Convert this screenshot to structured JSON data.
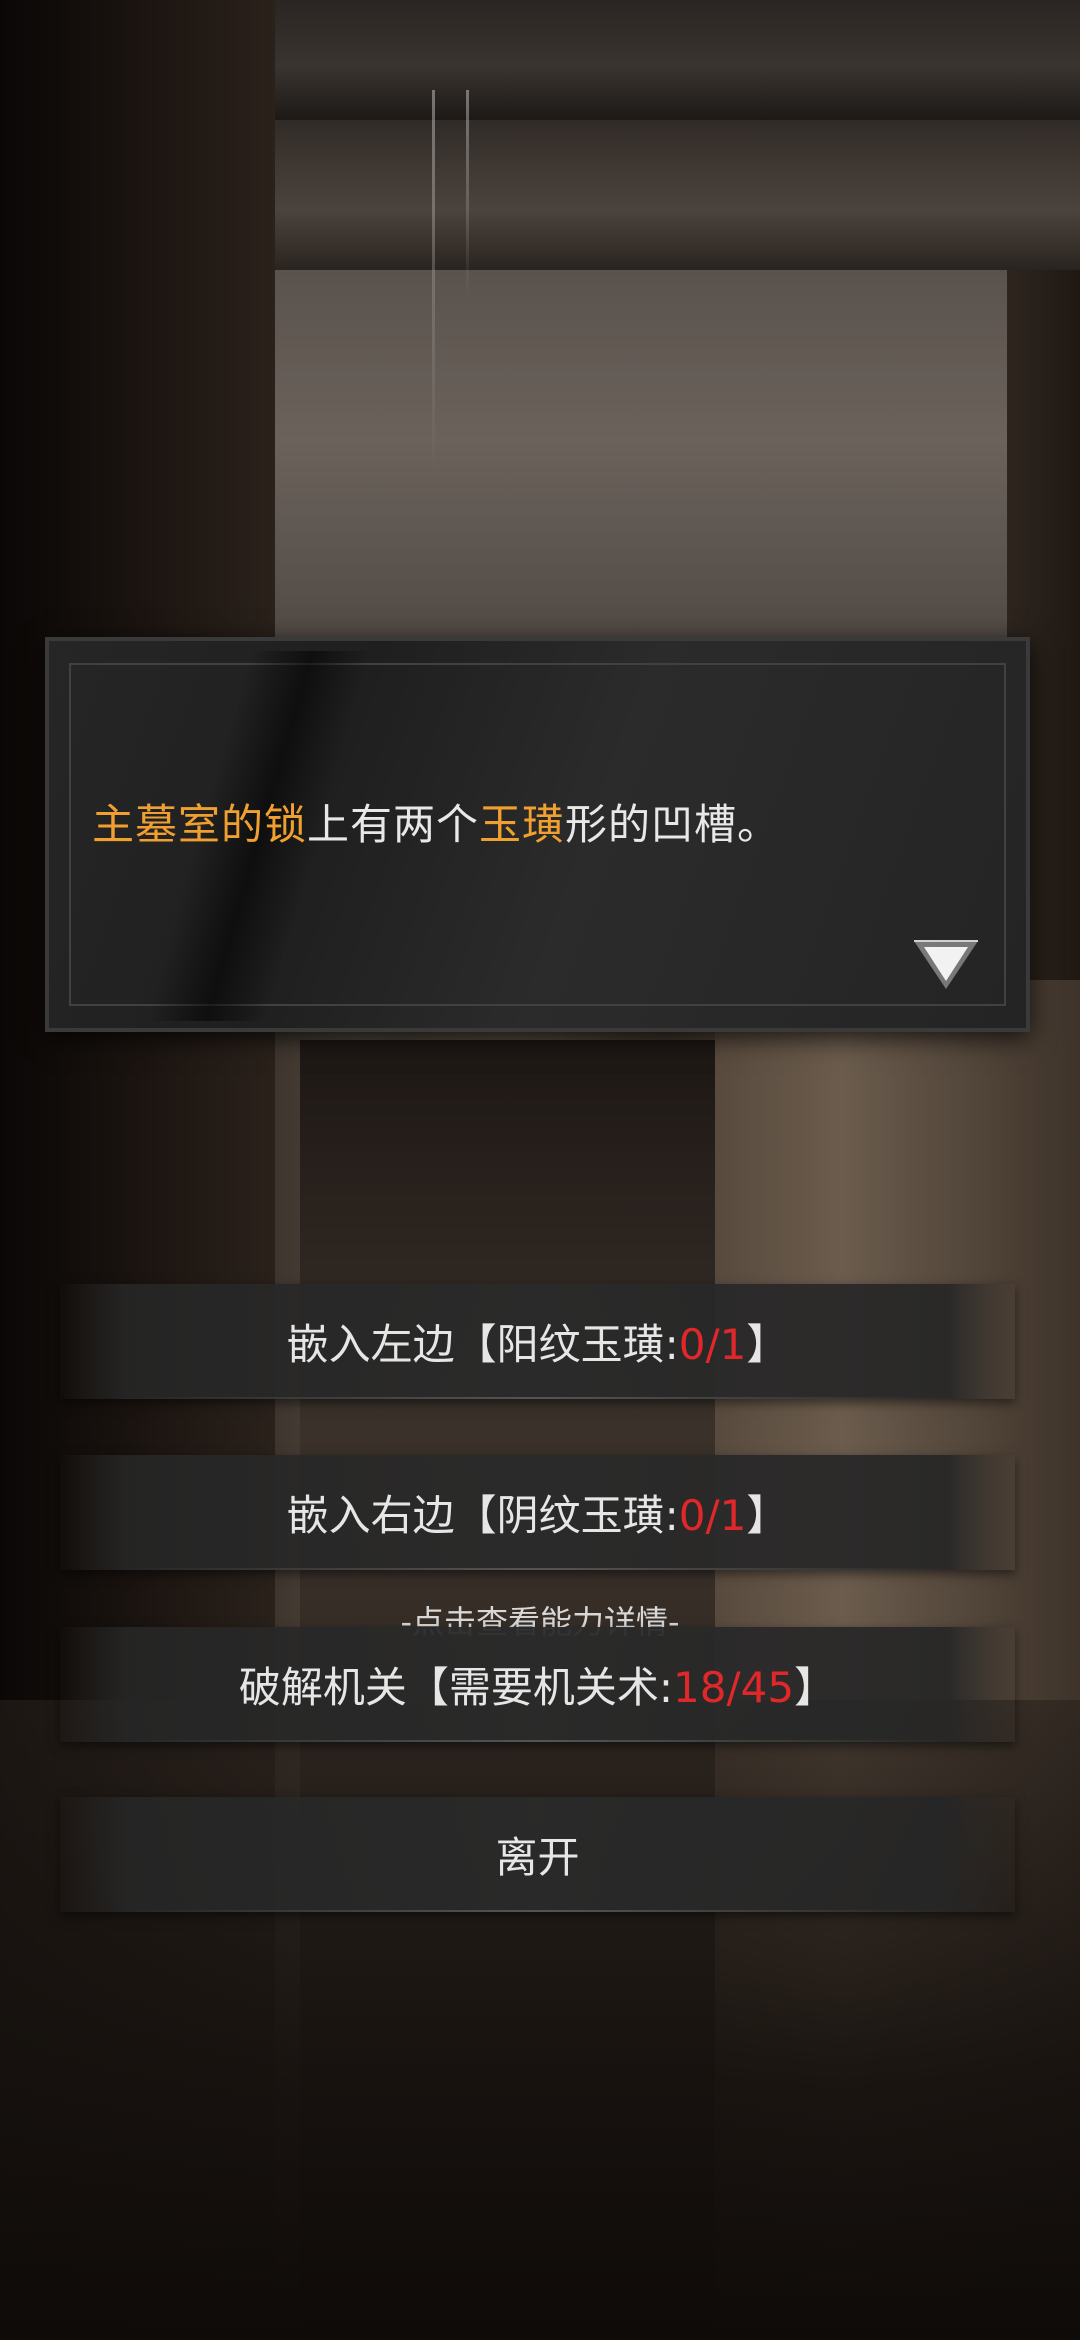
{
  "dialog": {
    "segments": [
      {
        "text": "主墓室的锁",
        "highlight": true
      },
      {
        "text": "上有两个",
        "highlight": false
      },
      {
        "text": "玉璜",
        "highlight": true
      },
      {
        "text": "形的凹槽。",
        "highlight": false
      }
    ],
    "continue_icon": "triangle-down-icon"
  },
  "options": [
    {
      "prefix": "嵌入左边【阳纹玉璜:",
      "value": "0/1",
      "suffix": "】"
    },
    {
      "prefix": "嵌入右边【阴纹玉璜:",
      "value": "0/1",
      "suffix": "】"
    },
    {
      "prefix": "破解机关【需要机关术:",
      "value": "18/45",
      "suffix": "】"
    },
    {
      "prefix": "离开",
      "value": "",
      "suffix": ""
    }
  ],
  "hint": "-点击查看能力详情-",
  "colors": {
    "highlight": "#f0a030",
    "requirement_value": "#e0282b"
  }
}
